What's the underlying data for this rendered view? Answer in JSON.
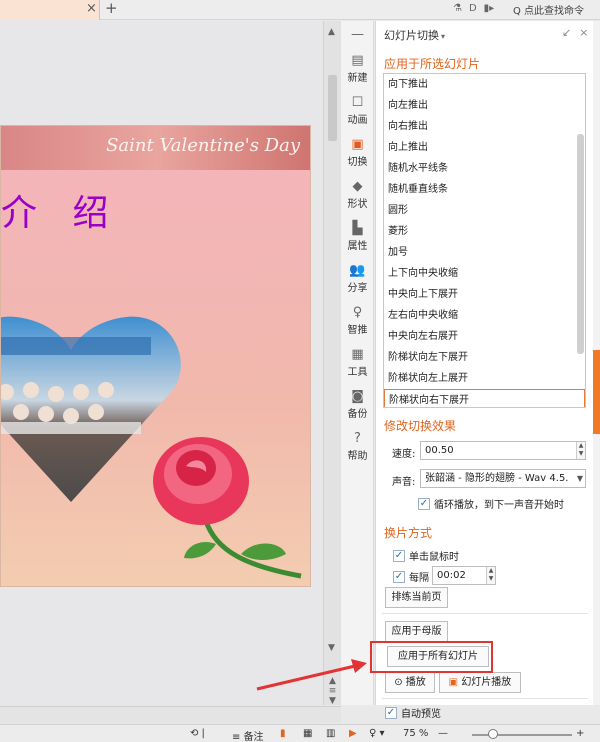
{
  "topbar": {
    "tab_close": "×",
    "tab_add": "+",
    "icons": [
      "⚗",
      "D",
      "▮▸"
    ],
    "search_text": "Q 点此查找命令"
  },
  "slide": {
    "banner_text": "Saint Valentine's Day",
    "title": "介 绍"
  },
  "sidebar": {
    "items": [
      {
        "label": "",
        "icon": "minus-icon",
        "glyph": "—"
      },
      {
        "label": "新建",
        "icon": "new-doc-icon",
        "glyph": "▤"
      },
      {
        "label": "动画",
        "icon": "animation-icon",
        "glyph": "☐"
      },
      {
        "label": "切换",
        "icon": "transition-icon",
        "glyph": "▣",
        "active": true
      },
      {
        "label": "形状",
        "icon": "shape-icon",
        "glyph": "◆"
      },
      {
        "label": "属性",
        "icon": "property-icon",
        "glyph": "▙"
      },
      {
        "label": "分享",
        "icon": "share-icon",
        "glyph": "👥"
      },
      {
        "label": "智推",
        "icon": "smart-icon",
        "glyph": "♀"
      },
      {
        "label": "工具",
        "icon": "toolbox-icon",
        "glyph": "▦"
      },
      {
        "label": "备份",
        "icon": "backup-icon",
        "glyph": "◙"
      },
      {
        "label": "帮助",
        "icon": "help-icon",
        "glyph": "?"
      }
    ]
  },
  "panel": {
    "title": "幻灯片切换",
    "caret": "▾",
    "pin_icon": "↙",
    "close_icon": "×",
    "apply_selected_title": "应用于所选幻灯片",
    "transitions": [
      "向下推出",
      "向左推出",
      "向右推出",
      "向上推出",
      "随机水平线条",
      "随机垂直线条",
      "圆形",
      "菱形",
      "加号",
      "上下向中央收缩",
      "中央向上下展开",
      "左右向中央收缩",
      "中央向左右展开",
      "阶梯状向左下展开",
      "阶梯状向左上展开",
      "阶梯状向右下展开"
    ],
    "selected_transition": "阶梯状向右下展开",
    "modify_effect_title": "修改切换效果",
    "speed_label": "速度:",
    "speed_value": "00.50",
    "sound_label": "声音:",
    "sound_value": "张韶涵 - 隐形的翅膀 - Wav 4.5.",
    "loop_label": "循环播放，到下一声音开始时",
    "advance_title": "换片方式",
    "on_click_label": "单击鼠标时",
    "every_label": "每隔",
    "every_value": "00:02",
    "rehearse_button": "排练当前页",
    "apply_master_button": "应用于母版",
    "apply_all_button": "应用于所有幻灯片",
    "play_button": "播放",
    "slideshow_button": "幻灯片播放",
    "auto_preview_label": "自动预览"
  },
  "statusbar": {
    "notes": "备注",
    "zoom": "75 %",
    "minus": "—",
    "plus": "+"
  },
  "colors": {
    "accent": "#e2641e",
    "highlight": "#e23434",
    "title_purple": "#9a00c8"
  }
}
